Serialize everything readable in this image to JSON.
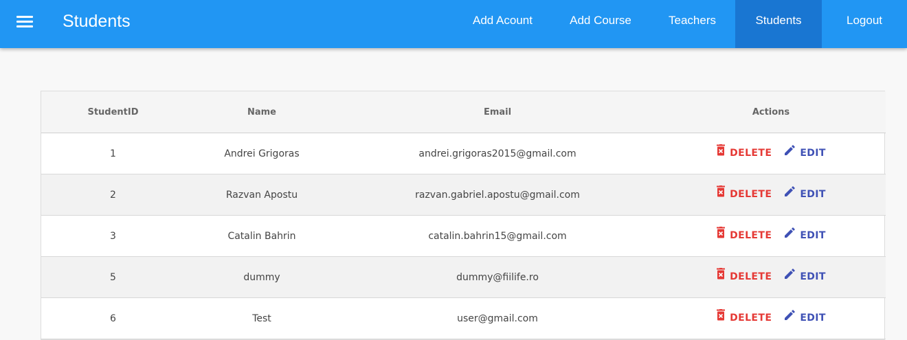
{
  "appbar": {
    "title": "Students",
    "nav": [
      {
        "label": "Add Acount",
        "active": false
      },
      {
        "label": "Add Course",
        "active": false
      },
      {
        "label": "Teachers",
        "active": false
      },
      {
        "label": "Students",
        "active": true
      },
      {
        "label": "Logout",
        "active": false
      }
    ]
  },
  "table": {
    "headers": [
      "StudentID",
      "Name",
      "Email",
      "Actions"
    ],
    "rows": [
      {
        "id": "1",
        "name": "Andrei Grigoras",
        "email": "andrei.grigoras2015@gmail.com"
      },
      {
        "id": "2",
        "name": "Razvan Apostu",
        "email": "razvan.gabriel.apostu@gmail.com"
      },
      {
        "id": "3",
        "name": "Catalin Bahrin",
        "email": "catalin.bahrin15@gmail.com"
      },
      {
        "id": "5",
        "name": "dummy",
        "email": "dummy@fiilife.ro"
      },
      {
        "id": "6",
        "name": "Test",
        "email": "user@gmail.com"
      }
    ],
    "delete_label": "DELETE",
    "edit_label": "EDIT"
  },
  "icons": {
    "menu": "menu-icon",
    "delete": "delete-forever-icon",
    "edit": "pencil-icon"
  },
  "colors": {
    "appbar": "#2196f3",
    "active_nav": "#1976d2",
    "delete": "#e53935",
    "edit": "#3f51b5"
  }
}
